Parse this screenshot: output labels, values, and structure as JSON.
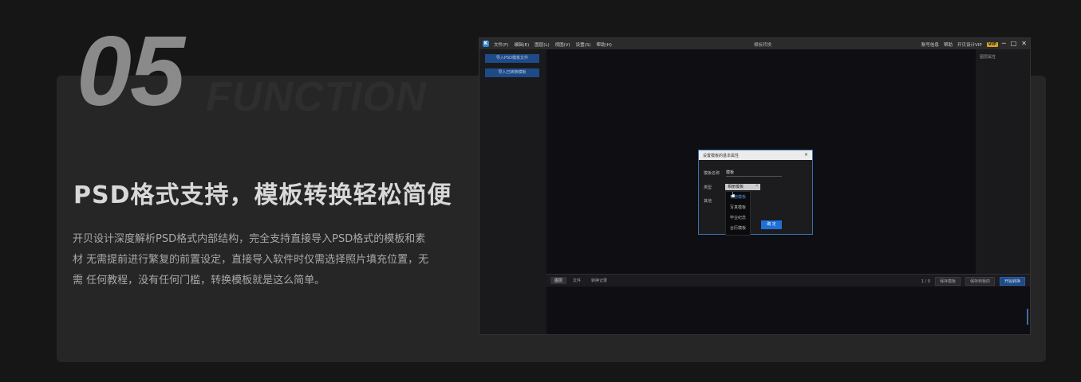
{
  "hero": {
    "number": "05",
    "word": "FUNCTION",
    "title": "PSD格式支持，模板转换轻松简便",
    "desc": [
      "开贝设计深度解析PSD格式内部结构，完全支持直接导入PSD格式的模板和素",
      "材 无需提前进行繁复的前置设定，直接导入软件时仅需选择照片填充位置，无",
      "需 任何教程，没有任何门槛，转换模板就是这么简单。"
    ]
  },
  "app": {
    "logo": "K",
    "menu": [
      "文件(F)",
      "编辑(E)",
      "图层(L)",
      "视图(V)",
      "设置(S)",
      "帮助(H)"
    ],
    "window_title": "模板转换",
    "right_info": [
      "账号信息",
      "帮助",
      "开贝设计VIP"
    ],
    "vip_badge": "VIP",
    "win_buttons": [
      "─",
      "□",
      "✕"
    ],
    "left_buttons": [
      "导入PSD模板文件",
      "导入已转换模板"
    ],
    "right_panel_label": "图层属性",
    "bottom_tabs": [
      "图层",
      "文件",
      "转换记录"
    ],
    "bottom_controls": {
      "zoom": "1 / 0",
      "btn1": "保存模板",
      "btn2": "保存到我的",
      "btn3": "开始转换"
    }
  },
  "dialog": {
    "title": "设置模板的基本属性",
    "close": "×",
    "name_label": "模板名称",
    "name_value": "模板",
    "type_label": "类型",
    "type_value": "相册模板",
    "other_label": "其他",
    "options": [
      "相册模板",
      "写真模板",
      "毕业纪念",
      "台历模板"
    ],
    "confirm": "确 定"
  },
  "colors": {
    "accent": "#1f6fd6",
    "nav_button": "#1e4a86",
    "vip": "#d9a227"
  }
}
